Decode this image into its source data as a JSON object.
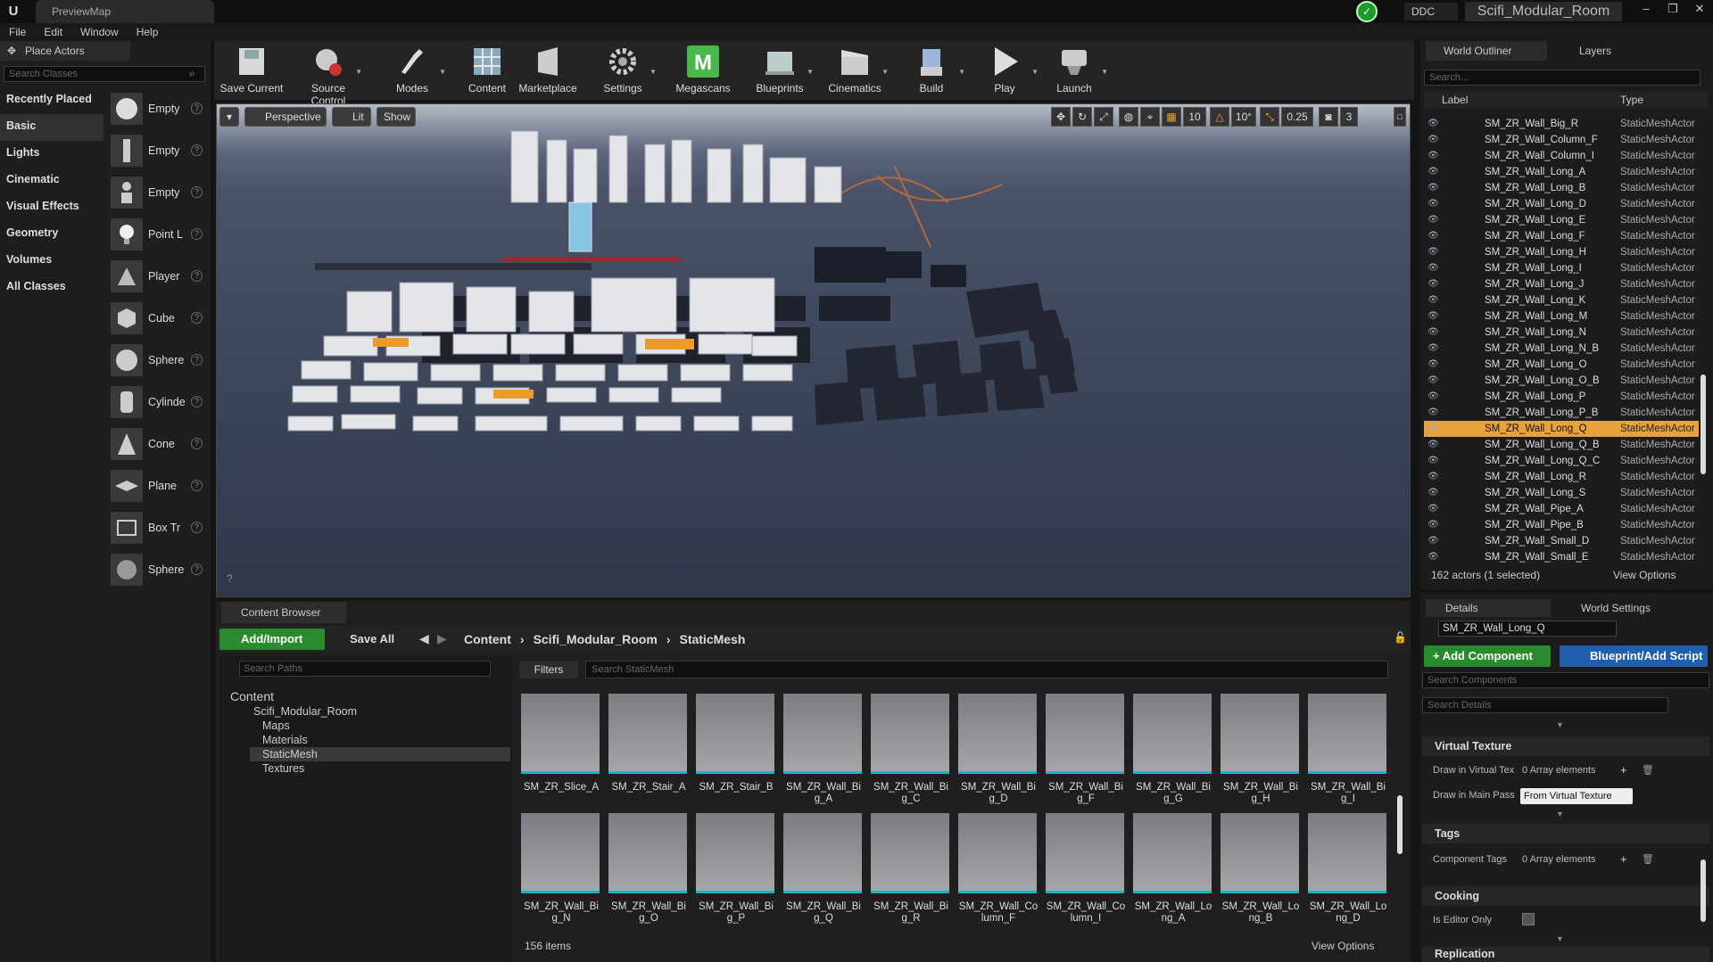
{
  "titlebar": {
    "map_tab": "PreviewMap",
    "ddc": "DDC",
    "project": "Scifi_Modular_Room",
    "window_buttons": [
      "–",
      "❐",
      "✕"
    ]
  },
  "menu": [
    "File",
    "Edit",
    "Window",
    "Help"
  ],
  "place_actors": {
    "title": "Place Actors",
    "search_placeholder": "Search Classes",
    "categories": [
      "Recently Placed",
      "Basic",
      "Lights",
      "Cinematic",
      "Visual Effects",
      "Geometry",
      "Volumes",
      "All Classes"
    ],
    "actors": [
      "Empty",
      "Empty",
      "Empty",
      "Point L",
      "Player",
      "Cube",
      "Sphere",
      "Cylinde",
      "Cone",
      "Plane",
      "Box Tr",
      "Sphere"
    ]
  },
  "toolbar": [
    "Save Current",
    "Source Control",
    "Modes",
    "Content",
    "Marketplace",
    "Settings",
    "Megascans",
    "Blueprints",
    "Cinematics",
    "Build",
    "Play",
    "Launch"
  ],
  "viewport": {
    "perspective": "Perspective",
    "lit": "Lit",
    "show": "Show",
    "grid_snap": "10",
    "rot_snap": "10°",
    "scale_snap": "0.25",
    "cam_speed": "3"
  },
  "content_browser": {
    "tab": "Content Browser",
    "add_import": "Add/Import",
    "save_all": "Save All",
    "breadcrumb": [
      "Content",
      "Scifi_Modular_Room",
      "StaticMesh"
    ],
    "search_paths": "Search Paths",
    "filters": "Filters",
    "search_placeholder": "Search StaticMesh",
    "tree": {
      "root": "Content",
      "project": "Scifi_Modular_Room",
      "folders": [
        "Maps",
        "Materials",
        "StaticMesh",
        "Textures"
      ]
    },
    "row1": [
      "SM_ZR_Slice_A",
      "SM_ZR_Stair_A",
      "SM_ZR_Stair_B",
      "SM_ZR_Wall_Big_A",
      "SM_ZR_Wall_Big_C",
      "SM_ZR_Wall_Big_D",
      "SM_ZR_Wall_Big_F",
      "SM_ZR_Wall_Big_G",
      "SM_ZR_Wall_Big_H",
      "SM_ZR_Wall_Big_I"
    ],
    "row2": [
      "SM_ZR_Wall_Big_N",
      "SM_ZR_Wall_Big_O",
      "SM_ZR_Wall_Big_P",
      "SM_ZR_Wall_Big_Q",
      "SM_ZR_Wall_Big_R",
      "SM_ZR_Wall_Column_F",
      "SM_ZR_Wall_Column_I",
      "SM_ZR_Wall_Long_A",
      "SM_ZR_Wall_Long_B",
      "SM_ZR_Wall_Long_D"
    ],
    "items_count": "156 items",
    "view_options": "View Options"
  },
  "outliner": {
    "tab": "World Outliner",
    "layers_tab": "Layers",
    "search_placeholder": "Search...",
    "col_label": "Label",
    "col_type": "Type",
    "rows": [
      "SM_ZR_Wall_Big_R",
      "SM_ZR_Wall_Column_F",
      "SM_ZR_Wall_Column_I",
      "SM_ZR_Wall_Long_A",
      "SM_ZR_Wall_Long_B",
      "SM_ZR_Wall_Long_D",
      "SM_ZR_Wall_Long_E",
      "SM_ZR_Wall_Long_F",
      "SM_ZR_Wall_Long_H",
      "SM_ZR_Wall_Long_I",
      "SM_ZR_Wall_Long_J",
      "SM_ZR_Wall_Long_K",
      "SM_ZR_Wall_Long_M",
      "SM_ZR_Wall_Long_N",
      "SM_ZR_Wall_Long_N_B",
      "SM_ZR_Wall_Long_O",
      "SM_ZR_Wall_Long_O_B",
      "SM_ZR_Wall_Long_P",
      "SM_ZR_Wall_Long_P_B",
      "SM_ZR_Wall_Long_Q",
      "SM_ZR_Wall_Long_Q_B",
      "SM_ZR_Wall_Long_Q_C",
      "SM_ZR_Wall_Long_R",
      "SM_ZR_Wall_Long_S",
      "SM_ZR_Wall_Pipe_A",
      "SM_ZR_Wall_Pipe_B",
      "SM_ZR_Wall_Small_D",
      "SM_ZR_Wall_Small_E"
    ],
    "row_type": "StaticMeshActor",
    "selected": "SM_ZR_Wall_Long_Q",
    "status": "162 actors (1 selected)",
    "view_options": "View Options"
  },
  "details": {
    "tab": "Details",
    "world_settings_tab": "World Settings",
    "name": "SM_ZR_Wall_Long_Q",
    "add_component": "+ Add Component",
    "blueprint_add": "Blueprint/Add Script",
    "search_components": "Search Components",
    "search_details": "Search Details",
    "virtual_texture": "Virtual Texture",
    "draw_in_vt": "Draw in Virtual Tex",
    "draw_in_vt_val": "0 Array elements",
    "draw_main_pass": "Draw in Main Pass",
    "draw_main_pass_val": "From Virtual Texture",
    "tags": "Tags",
    "component_tags": "Component Tags",
    "component_tags_val": "0 Array elements",
    "cooking": "Cooking",
    "is_editor_only": "Is Editor Only",
    "replication": "Replication"
  },
  "colors": {
    "accent_green": "#2a8a2e",
    "selection": "#e8a23a",
    "asset_underline": "#19b5c7",
    "blueprint_blue": "#1f5fae"
  }
}
